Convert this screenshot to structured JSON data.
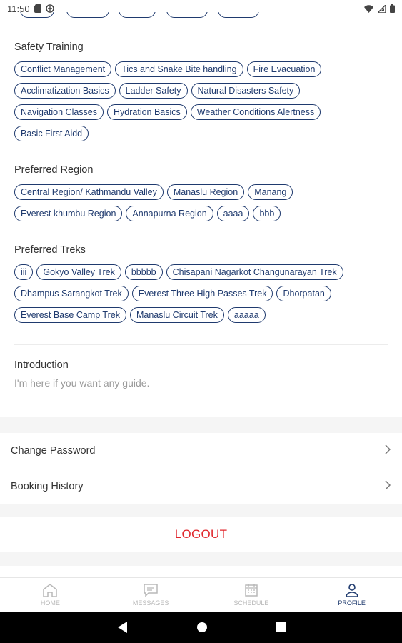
{
  "status_bar": {
    "time": "11:50"
  },
  "sections": {
    "safety_training": {
      "title": "Safety Training",
      "chips": [
        "Conflict Management",
        "Tics and Snake Bite handling",
        "Fire Evacuation",
        "Acclimatization Basics",
        "Ladder Safety",
        "Natural Disasters Safety",
        "Navigation Classes",
        "Hydration Basics",
        "Weather Conditions Alertness",
        "Basic First Aidd"
      ]
    },
    "preferred_region": {
      "title": "Preferred Region",
      "chips": [
        "Central Region/ Kathmandu Valley",
        "Manaslu Region",
        "Manang",
        "Everest khumbu Region",
        "Annapurna Region",
        "aaaa",
        "bbb"
      ]
    },
    "preferred_treks": {
      "title": "Preferred Treks",
      "chips": [
        "iii",
        "Gokyo Valley Trek",
        "bbbbb",
        "Chisapani Nagarkot Changunarayan Trek",
        "Dhampus Sarangkot Trek",
        "Everest Three High Passes Trek",
        "Dhorpatan",
        "Everest Base Camp Trek",
        "Manaslu Circuit Trek",
        "aaaaa"
      ]
    }
  },
  "introduction": {
    "label": "Introduction",
    "text": "I'm here if you want any guide."
  },
  "menu": {
    "change_password": "Change Password",
    "booking_history": "Booking History",
    "logout": "LOGOUT"
  },
  "bottom_nav": {
    "home": "HOME",
    "messages": "MESSAGES",
    "schedule": "SCHEDULE",
    "profile": "PROFILE"
  },
  "colors": {
    "accent": "#1f3a6e",
    "logout": "#e0252b",
    "inactive": "#b8b8b8"
  }
}
